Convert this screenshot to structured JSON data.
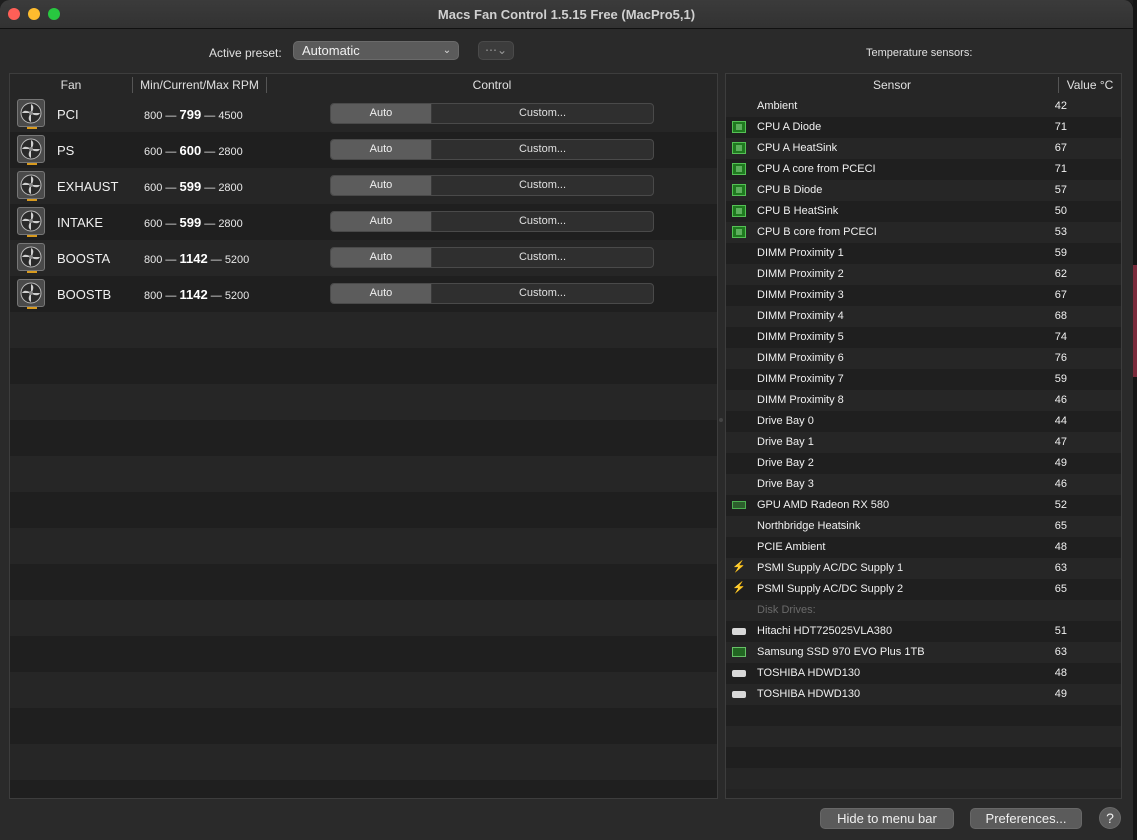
{
  "window": {
    "title": "Macs Fan Control 1.5.15 Free (MacPro5,1)"
  },
  "toolbar": {
    "preset_label": "Active preset:",
    "preset_value": "Automatic",
    "more_icon": "ellipsis-circle-icon",
    "sensors_label": "Temperature sensors:"
  },
  "fan_table": {
    "headers": {
      "fan": "Fan",
      "rpm": "Min/Current/Max RPM",
      "control": "Control"
    },
    "dash": "—",
    "fans": [
      {
        "name": "PCI",
        "min": "800",
        "current": "799",
        "max": "4500",
        "auto": "Auto",
        "custom": "Custom..."
      },
      {
        "name": "PS",
        "min": "600",
        "current": "600",
        "max": "2800",
        "auto": "Auto",
        "custom": "Custom..."
      },
      {
        "name": "EXHAUST",
        "min": "600",
        "current": "599",
        "max": "2800",
        "auto": "Auto",
        "custom": "Custom..."
      },
      {
        "name": "INTAKE",
        "min": "600",
        "current": "599",
        "max": "2800",
        "auto": "Auto",
        "custom": "Custom..."
      },
      {
        "name": "BOOSTA",
        "min": "800",
        "current": "1142",
        "max": "5200",
        "auto": "Auto",
        "custom": "Custom..."
      },
      {
        "name": "BOOSTB",
        "min": "800",
        "current": "1142",
        "max": "5200",
        "auto": "Auto",
        "custom": "Custom..."
      }
    ]
  },
  "sensor_table": {
    "headers": {
      "sensor": "Sensor",
      "value": "Value °C"
    },
    "rows": [
      {
        "icon": "none",
        "name": "Ambient",
        "value": "42"
      },
      {
        "icon": "cpu-chip-icon",
        "name": "CPU A Diode",
        "value": "71"
      },
      {
        "icon": "cpu-chip-icon",
        "name": "CPU A HeatSink",
        "value": "67"
      },
      {
        "icon": "cpu-chip-icon",
        "name": "CPU A core from PCECI",
        "value": "71"
      },
      {
        "icon": "cpu-chip-icon",
        "name": "CPU B Diode",
        "value": "57"
      },
      {
        "icon": "cpu-chip-icon",
        "name": "CPU B HeatSink",
        "value": "50"
      },
      {
        "icon": "cpu-chip-icon",
        "name": "CPU B core from PCECI",
        "value": "53"
      },
      {
        "icon": "none",
        "name": "DIMM Proximity 1",
        "value": "59"
      },
      {
        "icon": "none",
        "name": "DIMM Proximity 2",
        "value": "62"
      },
      {
        "icon": "none",
        "name": "DIMM Proximity 3",
        "value": "67"
      },
      {
        "icon": "none",
        "name": "DIMM Proximity 4",
        "value": "68"
      },
      {
        "icon": "none",
        "name": "DIMM Proximity 5",
        "value": "74"
      },
      {
        "icon": "none",
        "name": "DIMM Proximity 6",
        "value": "76"
      },
      {
        "icon": "none",
        "name": "DIMM Proximity 7",
        "value": "59"
      },
      {
        "icon": "none",
        "name": "DIMM Proximity 8",
        "value": "46"
      },
      {
        "icon": "none",
        "name": "Drive Bay 0",
        "value": "44"
      },
      {
        "icon": "none",
        "name": "Drive Bay 1",
        "value": "47"
      },
      {
        "icon": "none",
        "name": "Drive Bay 2",
        "value": "49"
      },
      {
        "icon": "none",
        "name": "Drive Bay 3",
        "value": "46"
      },
      {
        "icon": "gpu-card-icon",
        "name": "GPU AMD Radeon RX 580",
        "value": "52"
      },
      {
        "icon": "none",
        "name": "Northbridge Heatsink",
        "value": "65"
      },
      {
        "icon": "none",
        "name": "PCIE Ambient",
        "value": "48"
      },
      {
        "icon": "lightning-bolt-icon",
        "name": "PSMI Supply AC/DC Supply 1",
        "value": "63"
      },
      {
        "icon": "lightning-bolt-icon",
        "name": "PSMI Supply AC/DC Supply 2",
        "value": "65"
      },
      {
        "group": "Disk Drives:"
      },
      {
        "icon": "hard-disk-icon",
        "name": "Hitachi HDT725025VLA380",
        "value": "51"
      },
      {
        "icon": "ssd-icon",
        "name": "Samsung SSD 970 EVO Plus 1TB",
        "value": "63"
      },
      {
        "icon": "hard-disk-icon",
        "name": "TOSHIBA HDWD130",
        "value": "48"
      },
      {
        "icon": "hard-disk-icon",
        "name": "TOSHIBA HDWD130",
        "value": "49"
      }
    ]
  },
  "footer": {
    "hide_label": "Hide to menu bar",
    "prefs_label": "Preferences...",
    "help_label": "?"
  }
}
